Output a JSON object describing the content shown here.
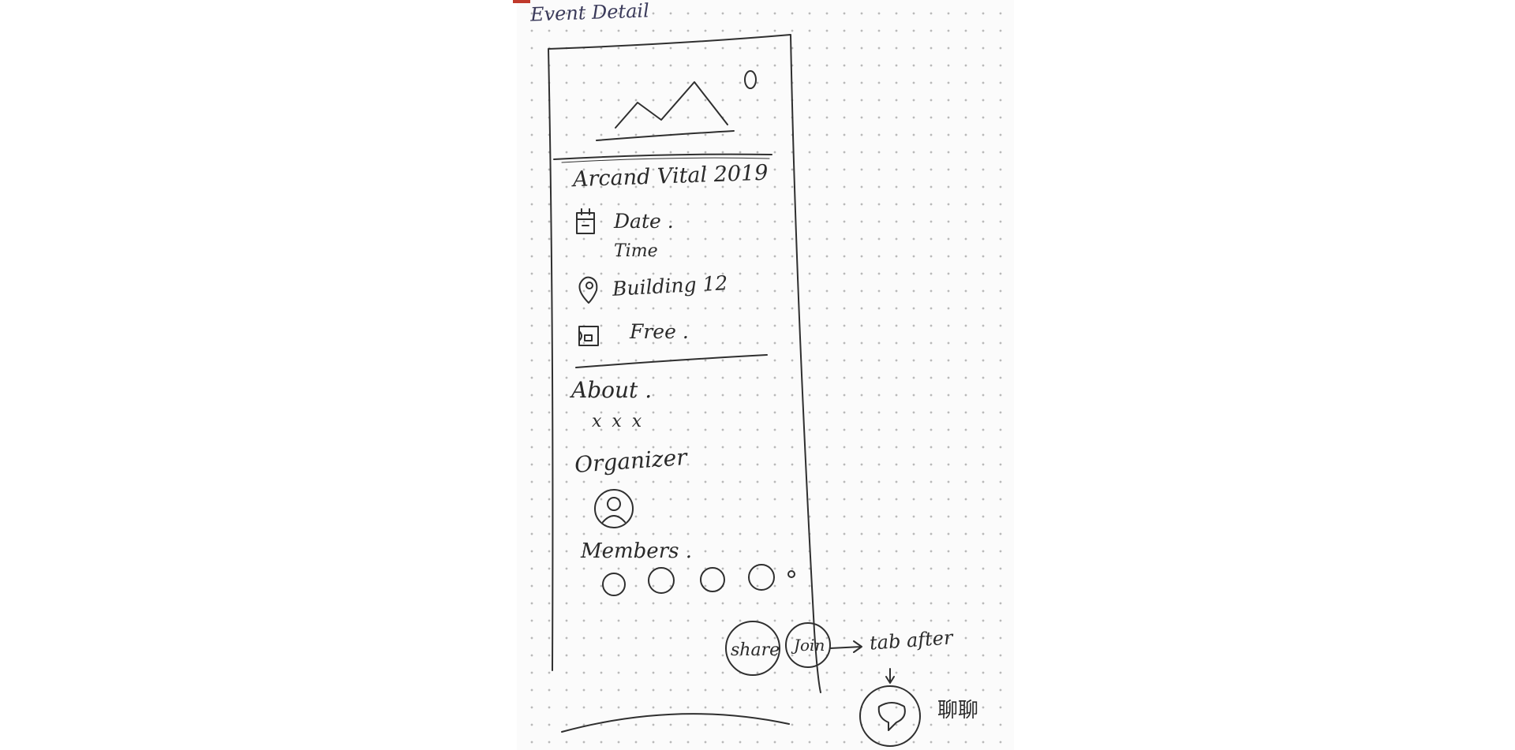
{
  "sheet": {
    "title": "Event Detail",
    "ink_color": "#2a2a2a",
    "paper_color": "#fbfbfb",
    "dot_color": "#b9b9b9"
  },
  "phone": {
    "header": {
      "image_icon": "mountain-image-placeholder-icon",
      "corner_icon": "circle-icon"
    },
    "event_name": "Arcand Vital 2019",
    "details": {
      "date_icon": "calendar-icon",
      "date_label": "Date .",
      "time_label": "Time",
      "location_icon": "location-pin-icon",
      "location_label": "Building 12",
      "price_icon": "ticket-icon",
      "price_label": "Free ."
    },
    "about": {
      "heading": "About .",
      "text": "x x x"
    },
    "organizer": {
      "heading": "Organizer",
      "avatar_icon": "person-avatar-icon"
    },
    "members": {
      "heading": "Members .",
      "count_shown": 4
    },
    "actions": {
      "share_label": "share",
      "join_label": "Join"
    }
  },
  "annotations": {
    "tab_after": "tab after",
    "chat_icon": "chat-bubble-icon",
    "chinese_label": "聊聊"
  }
}
